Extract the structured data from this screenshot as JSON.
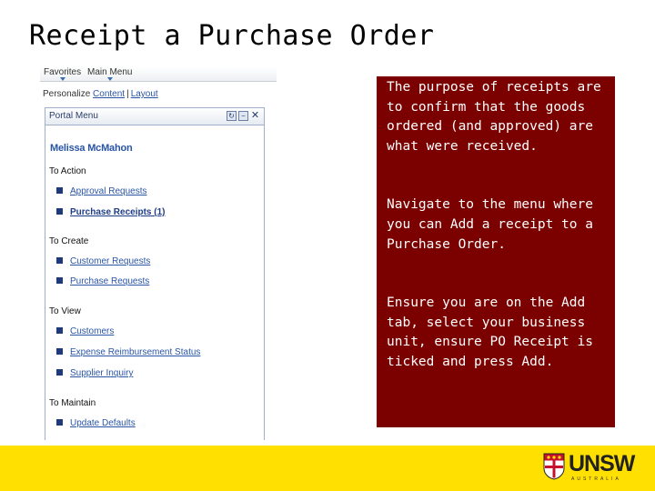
{
  "slide": {
    "title": "Receipt a Purchase Order"
  },
  "portal": {
    "nav": {
      "favorites": "Favorites",
      "main_menu": "Main Menu"
    },
    "personalize": {
      "label": "Personalize",
      "content": "Content",
      "separator": "|",
      "layout": "Layout"
    },
    "menu": {
      "title": "Portal Menu",
      "user": "Melissa McMahon",
      "sections": [
        {
          "header": "To Action",
          "items": [
            "Approval Requests",
            "Purchase Receipts (1)"
          ]
        },
        {
          "header": "To Create",
          "items": [
            "Customer Requests",
            "Purchase Requests"
          ]
        },
        {
          "header": "To View",
          "items": [
            "Customers",
            "Expense Reimbursement Status",
            "Supplier Inquiry"
          ]
        },
        {
          "header": "To Maintain",
          "items": [
            "Update Defaults"
          ]
        }
      ]
    }
  },
  "notes": [
    "The purpose of receipts are to confirm that the goods ordered (and approved) are what were received.",
    "Navigate to the menu where you can Add a receipt to a Purchase Order.",
    "Ensure you are on the Add tab, select your business unit, ensure PO Receipt is ticked and press Add."
  ],
  "logo": {
    "wordmark": "UNSW",
    "subline": "AUSTRALIA"
  },
  "colors": {
    "notes_bg": "#7b0000",
    "footer_bg": "#ffe000",
    "link": "#2a55a6"
  }
}
